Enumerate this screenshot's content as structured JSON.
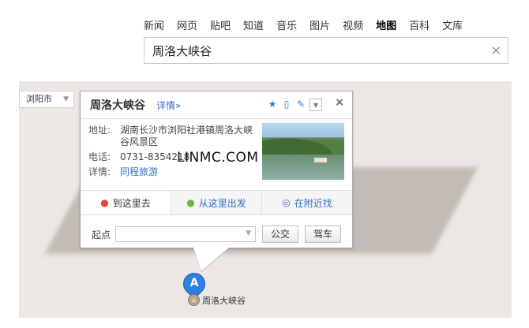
{
  "nav": {
    "items": [
      "新闻",
      "网页",
      "贴吧",
      "知道",
      "音乐",
      "图片",
      "视频",
      "地图",
      "百科",
      "文库"
    ],
    "active": "地图"
  },
  "search": {
    "value": "周洛大峡谷",
    "clear_icon": "×"
  },
  "map": {
    "city": "浏阳市",
    "background": "#ebe7e2"
  },
  "popup": {
    "title": "周洛大峡谷",
    "detail_link": "详情»",
    "header_icons": [
      "star-icon",
      "phone-icon",
      "edit-icon",
      "dropdown-icon"
    ],
    "close": "×",
    "address_label": "地址:",
    "address": "湖南长沙市浏阳社港镇周洛大峡谷风景区",
    "phone_label": "电话:",
    "phone": "0731-8354218",
    "detail_label": "详情:",
    "detail_value": "同程旅游",
    "tabs": [
      "到这里去",
      "从这里出发",
      "在附近找"
    ],
    "route": {
      "start_label": "起点",
      "start_value": "",
      "bus_button": "公交",
      "drive_button": "驾车"
    }
  },
  "watermark": "LINMC.COM",
  "marker": {
    "letter": "A",
    "label": "周洛大峡谷"
  },
  "colors": {
    "link": "#3470c2",
    "marker": "#2e7fe0"
  }
}
